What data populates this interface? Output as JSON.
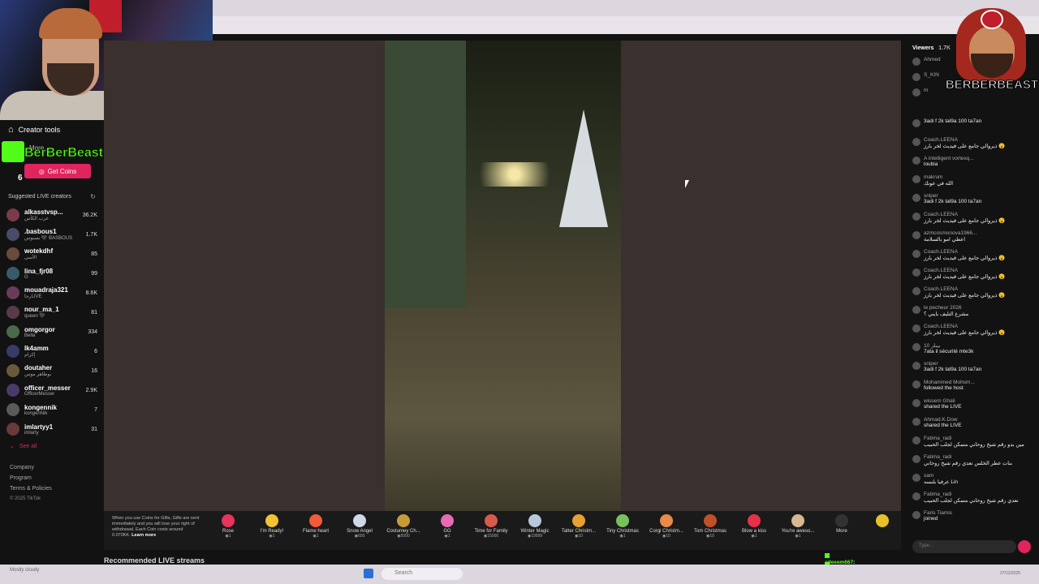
{
  "sidebar": {
    "creator_tools": "Creator tools",
    "more": "More",
    "get_coins": "Get Coins",
    "suggested_title": "Suggested LIVE creators",
    "creators": [
      {
        "name": "alkasstvsp...",
        "sub": "عرب الكأس",
        "count": "36.2K"
      },
      {
        "name": ".basbous1",
        "sub": "بسبوس 🖤 BASBOUS",
        "count": "1.7K"
      },
      {
        "name": "wotekdhf",
        "sub": "الأسي",
        "count": "85"
      },
      {
        "name": "lina_fjr08",
        "sub": "G",
        "count": "99"
      },
      {
        "name": "mouadraja321",
        "sub": "رجاLIVE",
        "count": "8.6K"
      },
      {
        "name": "nour_ma_1",
        "sub": "queen 🖤",
        "count": "81"
      },
      {
        "name": "omgorgor",
        "sub": "Bella",
        "count": "334"
      },
      {
        "name": "lk4amm",
        "sub": "إكرام",
        "count": "6"
      },
      {
        "name": "doutaher",
        "sub": "بوطاهر موس",
        "count": "16"
      },
      {
        "name": "officer_messer",
        "sub": "OfficerMesser",
        "count": "2.9K"
      },
      {
        "name": "kongennik",
        "sub": "kongenNik",
        "count": "7"
      },
      {
        "name": "imlartyy1",
        "sub": "imlarty",
        "count": "31"
      }
    ],
    "see_all": "See all",
    "footer": [
      "Company",
      "Program",
      "Terms & Policies",
      "© 2025 TikTok"
    ]
  },
  "overlay": {
    "brand": "BerBerBeast",
    "count": "6"
  },
  "stream_logo_text": "BERBERBEAST",
  "gift_notice": "When you use Coins for Gifts, Gifts are sent immediately and you will lose your right of withdrawal. Each Coin costs around 0.070KK.",
  "gift_learn_more": "Learn more",
  "gifts": [
    {
      "name": "Rose",
      "price": "1",
      "color": "#e8345a"
    },
    {
      "name": "I'm Ready!",
      "price": "1",
      "color": "#f2c230"
    },
    {
      "name": "Flame heart",
      "price": "1",
      "color": "#f25a3a"
    },
    {
      "name": "Snow Angel",
      "price": "600",
      "color": "#d0d8e8"
    },
    {
      "name": "Costumey Ch...",
      "price": "5000",
      "color": "#c79a3a"
    },
    {
      "name": "GG",
      "price": "1",
      "color": "#e86ab5"
    },
    {
      "name": "Time for Family",
      "price": "15000",
      "color": "#d85a4a"
    },
    {
      "name": "Winter Magic",
      "price": "19999",
      "color": "#b8c8d8"
    },
    {
      "name": "Tatter Christm...",
      "price": "10",
      "color": "#e8a030"
    },
    {
      "name": "Tiny Christmas",
      "price": "1",
      "color": "#7ac05a"
    },
    {
      "name": "Corgi Christm...",
      "price": "10",
      "color": "#e88a4a"
    },
    {
      "name": "Tom Christmas",
      "price": "10",
      "color": "#c0502a"
    },
    {
      "name": "Blow a kiss",
      "price": "1",
      "color": "#e8304a"
    },
    {
      "name": "You're aweso...",
      "price": "1",
      "color": "#d8b890"
    }
  ],
  "gift_more": "More",
  "recommended": "Recommended LIVE streams",
  "chat": {
    "viewers_label": "Viewers",
    "viewers_count": "1.7K",
    "top_viewers": [
      "Ahmed",
      "S_KIN",
      "m"
    ],
    "messages": [
      {
        "user": "",
        "text": "3adi f 2k tal9a 100 ta7an"
      },
      {
        "user": "Coach.LEENA",
        "text": "ذيروالي جامع على فيديث لخر بارز 😮"
      },
      {
        "user": "A intelligent vortexq...",
        "text": "loubia"
      },
      {
        "user": "makrum",
        "text": "الله في عونك"
      },
      {
        "user": "sniper",
        "text": "3adi f 2k tal9a 100 ta7an"
      },
      {
        "user": "Coach.LEENA",
        "text": "ذيروالي جامع على فيديث لخر بارز 😮"
      },
      {
        "user": "azmcosmonova1966...",
        "text": "اعطي امو بالسلامة"
      },
      {
        "user": "Coach.LEENA",
        "text": "ذيروالي جامع على فيديث لخر بارز 😮"
      },
      {
        "user": "Coach.LEENA",
        "text": "ذيروالي جامع على فيديث لخر بارز 😮"
      },
      {
        "user": "Coach.LEENA",
        "text": "ذيروالي جامع على فيديث لخر بارز 😮"
      },
      {
        "user": "le pecheur 2026",
        "text": "مشرع التليف بايني ؟"
      },
      {
        "user": "Coach.LEENA",
        "text": "ذيروالي جامع على فيديث لخر بارز 😮"
      },
      {
        "user": "10 بيبلز",
        "text": "7ata il sécurité mte3k"
      },
      {
        "user": "sniper",
        "text": "3adi f 2k tal9a 100 ta7an"
      },
      {
        "user": "Mohammed Mohsm...",
        "text": "followed the host"
      },
      {
        "user": "wissem Ghali",
        "text": "shared the LIVE"
      },
      {
        "user": "Ahmad.K.Dow",
        "text": "shared the LIVE"
      },
      {
        "user": "Fatima_radi",
        "text": "مين بدو رقم شيخ روحاني متمكن لجلب الحبيب"
      },
      {
        "user": "Fatima_radi",
        "text": "بنات عطر الخلس نعدي رقم شيخ روحاني"
      },
      {
        "user": "sam",
        "text": "عرفيا بلنسه Lin"
      },
      {
        "user": "Fatima_radi",
        "text": "نعدي رقم شيخ روحاني متمكن لجلب الحبيب"
      },
      {
        "user": "Faris Tiamis",
        "text": "joined"
      }
    ],
    "input_placeholder": "Type...",
    "overlay_lines": [
      {
        "user": "adeeem667",
        "text": ": yatla3 hata lel 5k hedha"
      },
      {
        "user": "adeeem667",
        "text": ": uk"
      }
    ]
  },
  "taskbar": {
    "search_placeholder": "Search",
    "weather": "Mostly cloudy",
    "time": "27/12/2025"
  }
}
